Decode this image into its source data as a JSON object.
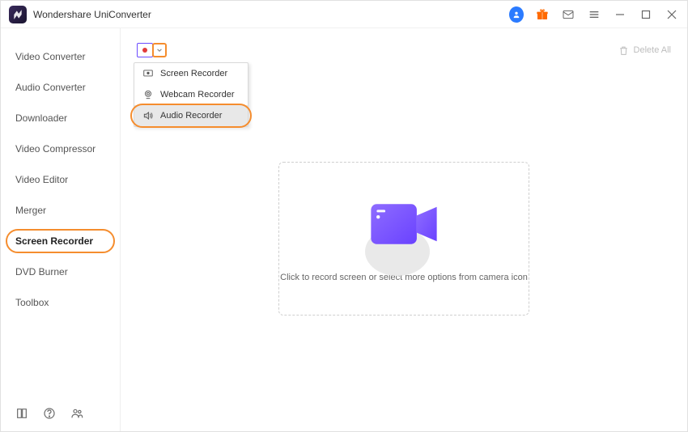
{
  "app": {
    "title": "Wondershare UniConverter"
  },
  "titlebar_icons": [
    "user-icon",
    "gift-icon",
    "mail-icon",
    "menu-icon",
    "minimize-icon",
    "maximize-icon",
    "close-icon"
  ],
  "sidebar": {
    "items": [
      {
        "label": "Video Converter",
        "active": false
      },
      {
        "label": "Audio Converter",
        "active": false
      },
      {
        "label": "Downloader",
        "active": false
      },
      {
        "label": "Video Compressor",
        "active": false
      },
      {
        "label": "Video Editor",
        "active": false
      },
      {
        "label": "Merger",
        "active": false
      },
      {
        "label": "Screen Recorder",
        "active": true
      },
      {
        "label": "DVD Burner",
        "active": false
      },
      {
        "label": "Toolbox",
        "active": false
      }
    ],
    "footer_icons": [
      "book-icon",
      "help-icon",
      "people-icon"
    ]
  },
  "toolbar": {
    "delete_all_label": "Delete All"
  },
  "dropdown": {
    "items": [
      {
        "label": "Screen Recorder",
        "icon": "screen-icon",
        "selected": false
      },
      {
        "label": "Webcam Recorder",
        "icon": "webcam-icon",
        "selected": false
      },
      {
        "label": "Audio Recorder",
        "icon": "audio-icon",
        "selected": true
      }
    ]
  },
  "dropzone": {
    "text": "Click to record screen or select more options from camera icon"
  },
  "colors": {
    "accent_orange": "#f58d2e",
    "accent_purple": "#7b52ff",
    "accent_blue": "#2b7bff"
  }
}
